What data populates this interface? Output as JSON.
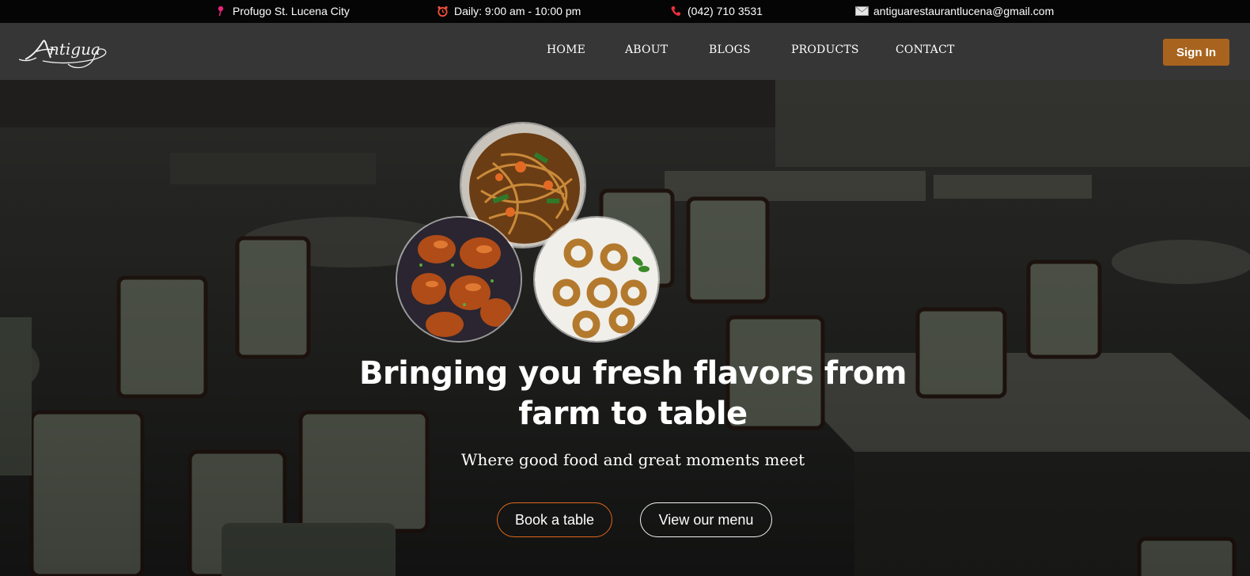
{
  "topbar": {
    "location": "Profugo St. Lucena City",
    "hours": "Daily: 9:00 am - 10:00 pm",
    "phone": "(042) 710 3531",
    "email": "antiguarestaurantlucena@gmail.com",
    "icons": [
      "map-pin-icon",
      "alarm-clock-icon",
      "phone-icon",
      "envelope-icon"
    ]
  },
  "navbar": {
    "logo": "Antigua",
    "links": [
      "HOME",
      "ABOUT",
      "BLOGS",
      "PRODUCTS",
      "CONTACT"
    ],
    "signin_label": "Sign In"
  },
  "hero": {
    "headline": "Bringing you fresh flavors from farm to table",
    "subline": "Where good food and great moments meet",
    "book_label": "Book a table",
    "menu_label": "View our menu",
    "plates": [
      "noodles-image",
      "chicken-image",
      "calamari-image"
    ]
  },
  "colors": {
    "topbar_bg": "#050505",
    "navbar_bg": "#363636",
    "signin_bg": "#a8641f",
    "book_border": "#e0661c"
  }
}
